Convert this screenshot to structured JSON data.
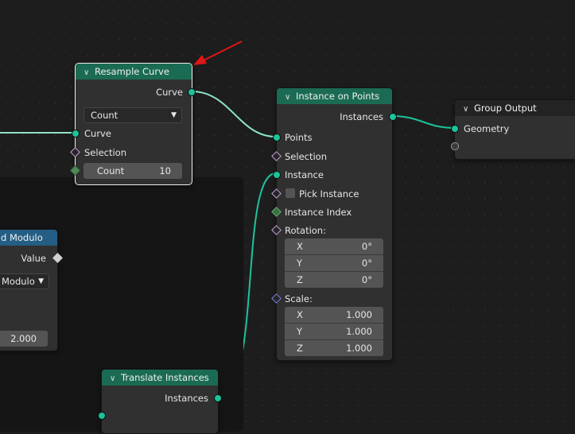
{
  "colors": {
    "geometry_socket": "#1dc39a",
    "green_header": "#1b6b54",
    "blue_header": "#245e84",
    "annotation_arrow": "#e01515"
  },
  "resample_curve": {
    "title": "Resample Curve",
    "output_curve": "Curve",
    "mode_value": "Count",
    "input_curve": "Curve",
    "selection": "Selection",
    "count_label": "Count",
    "count_value": "10"
  },
  "instance_on_points": {
    "title": "Instance on Points",
    "output_instances": "Instances",
    "points": "Points",
    "selection": "Selection",
    "instance": "Instance",
    "pick_instance": "Pick Instance",
    "instance_index": "Instance Index",
    "rotation_label": "Rotation:",
    "rotation": [
      {
        "axis": "X",
        "value": "0°"
      },
      {
        "axis": "Y",
        "value": "0°"
      },
      {
        "axis": "Z",
        "value": "0°"
      }
    ],
    "scale_label": "Scale:",
    "scale": [
      {
        "axis": "X",
        "value": "1.000"
      },
      {
        "axis": "Y",
        "value": "1.000"
      },
      {
        "axis": "Z",
        "value": "1.000"
      }
    ]
  },
  "group_output": {
    "title": "Group Output",
    "geometry": "Geometry"
  },
  "math_node": {
    "title": "d Modulo",
    "output_value": "Value",
    "mode_value": "Modulo",
    "value_field": "2.000"
  },
  "translate_instances": {
    "title": "Translate Instances",
    "output_instances": "Instances"
  }
}
